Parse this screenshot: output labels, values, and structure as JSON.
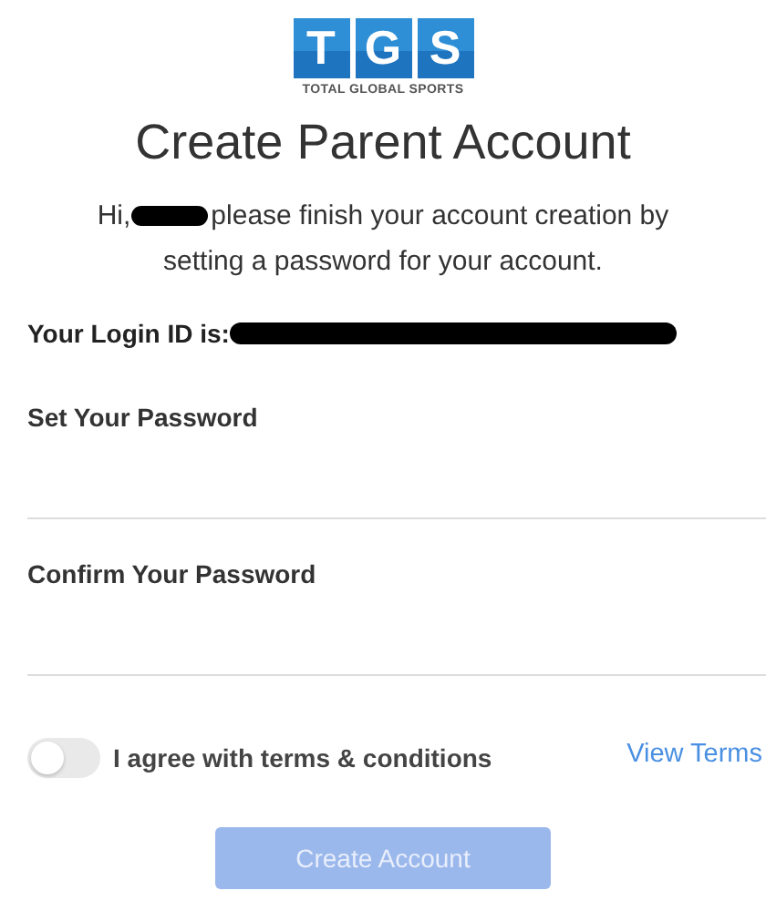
{
  "logo": {
    "letters": [
      "T",
      "G",
      "S"
    ],
    "tagline": "TOTAL GLOBAL SPORTS"
  },
  "title": "Create Parent Account",
  "greeting": {
    "salutation": "Hi,",
    "name_redacted": true,
    "line_1": "please finish your account creation by",
    "line_2": "setting a password for your account."
  },
  "login_id": {
    "label": "Your Login ID is:",
    "value_redacted": true
  },
  "fields": [
    {
      "label": "Set Your Password"
    },
    {
      "label": "Confirm Your Password"
    }
  ],
  "terms": {
    "label": "I agree with terms & conditions",
    "on": false,
    "link": "View Terms"
  },
  "submit": {
    "label": "Create Account",
    "disabled": true
  }
}
